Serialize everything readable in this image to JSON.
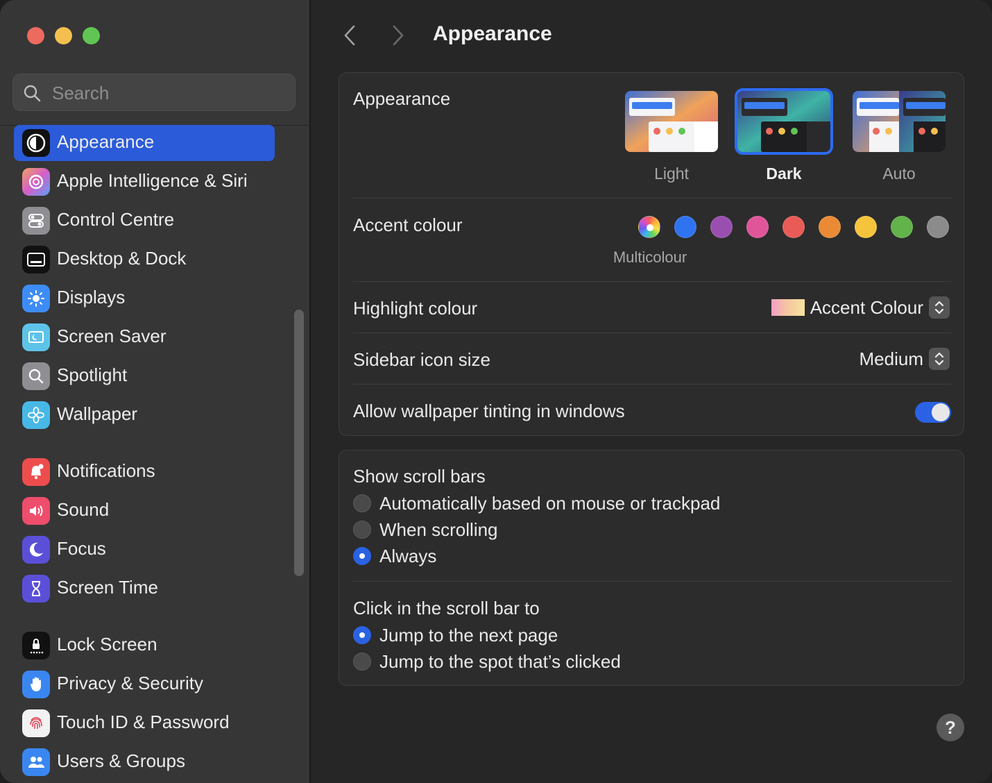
{
  "window": {
    "title": "Appearance"
  },
  "search": {
    "placeholder": "Search"
  },
  "sidebar": {
    "items": [
      {
        "label": "Appearance",
        "icon": "appearance-icon",
        "selected": true
      },
      {
        "label": "Apple Intelligence & Siri",
        "icon": "siri-icon"
      },
      {
        "label": "Control Centre",
        "icon": "control-centre-icon"
      },
      {
        "label": "Desktop & Dock",
        "icon": "dock-icon"
      },
      {
        "label": "Displays",
        "icon": "sun-icon"
      },
      {
        "label": "Screen Saver",
        "icon": "screen-saver-icon"
      },
      {
        "label": "Spotlight",
        "icon": "magnifier-icon"
      },
      {
        "label": "Wallpaper",
        "icon": "flower-icon"
      },
      {
        "label": "Notifications",
        "icon": "bell-icon"
      },
      {
        "label": "Sound",
        "icon": "speaker-icon"
      },
      {
        "label": "Focus",
        "icon": "moon-icon"
      },
      {
        "label": "Screen Time",
        "icon": "hourglass-icon"
      },
      {
        "label": "Lock Screen",
        "icon": "lock-icon"
      },
      {
        "label": "Privacy & Security",
        "icon": "hand-icon"
      },
      {
        "label": "Touch ID & Password",
        "icon": "fingerprint-icon"
      },
      {
        "label": "Users & Groups",
        "icon": "users-icon"
      }
    ]
  },
  "appearance_panel": {
    "appearance_label": "Appearance",
    "modes": [
      {
        "label": "Light",
        "selected": false
      },
      {
        "label": "Dark",
        "selected": true
      },
      {
        "label": "Auto",
        "selected": false
      }
    ],
    "accent_label": "Accent colour",
    "accent_colors": [
      {
        "name": "Multicolour",
        "color": "multicolour",
        "selected": true
      },
      {
        "name": "Blue",
        "color": "#2f73f0"
      },
      {
        "name": "Purple",
        "color": "#9a4fb0"
      },
      {
        "name": "Pink",
        "color": "#e0559a"
      },
      {
        "name": "Red",
        "color": "#e85b56"
      },
      {
        "name": "Orange",
        "color": "#ea8a35"
      },
      {
        "name": "Yellow",
        "color": "#f5c43c"
      },
      {
        "name": "Green",
        "color": "#62b34a"
      },
      {
        "name": "Graphite",
        "color": "#8b8b8b"
      }
    ],
    "accent_caption": "Multicolour",
    "highlight_label": "Highlight colour",
    "highlight_value": "Accent Colour",
    "icon_size_label": "Sidebar icon size",
    "icon_size_value": "Medium",
    "tinting_label": "Allow wallpaper tinting in windows",
    "tinting_on": true
  },
  "scroll_panel": {
    "show_label": "Show scroll bars",
    "show_options": [
      {
        "label": "Automatically based on mouse or trackpad",
        "selected": false
      },
      {
        "label": "When scrolling",
        "selected": false
      },
      {
        "label": "Always",
        "selected": true
      }
    ],
    "click_label": "Click in the scroll bar to",
    "click_options": [
      {
        "label": "Jump to the next page",
        "selected": true
      },
      {
        "label": "Jump to the spot that’s clicked",
        "selected": false
      }
    ]
  },
  "help": {
    "label": "?"
  },
  "colors": {
    "accent": "#2b5bd8",
    "sidebar_bg": "#363636",
    "content_bg": "#262626"
  }
}
